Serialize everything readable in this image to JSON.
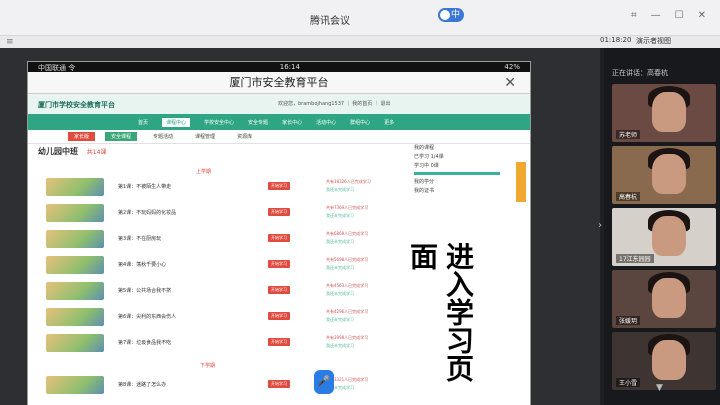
{
  "window": {
    "title": "腾讯会议",
    "lang_pill": "中",
    "timer": "01:18:20",
    "view_label": "演示者视图"
  },
  "phone": {
    "status_left": "中国联通 令",
    "status_time": "16:14",
    "status_right": "42%",
    "app_title": "厦门市安全教育平台",
    "close_symbol": "✕"
  },
  "site": {
    "logo_title": "厦门市学校安全教育平台",
    "user_text": "欢迎您，brambojhang1537 ｜ 我的首页 ｜ 退出",
    "nav": [
      "首页",
      "课程中心",
      "学校安全中心",
      "安全专题",
      "家长中心",
      "活动中心",
      "群组中心",
      "更多"
    ],
    "nav_active_index": 1,
    "subnav": [
      "家长版",
      "安全课程",
      "专题活动",
      "课程管理",
      "资源库"
    ],
    "course_head": "幼儿园中班",
    "course_count": "共14课",
    "term_top": "上学期",
    "term_bottom": "下学期",
    "lessons": [
      {
        "name": "第1课：不被陌生人带走",
        "btn": "开始学习",
        "stat": "共有18326人已完成学习",
        "stat2": "我还未完成学习"
      },
      {
        "name": "第2课：不玩妈妈的化妆品",
        "btn": "开始学习",
        "stat": "共有7369人已完成学习",
        "stat2": "我还未完成学习"
      },
      {
        "name": "第3课：不在厨房玩",
        "btn": "开始学习",
        "stat": "共有6869人已完成学习",
        "stat2": "我还未完成学习"
      },
      {
        "name": "第4课：荡秋千要小心",
        "btn": "开始学习",
        "stat": "共有5698人已完成学习",
        "stat2": "我还未完成学习"
      },
      {
        "name": "第5课：公共场合我不挤",
        "btn": "开始学习",
        "stat": "共有4563人已完成学习",
        "stat2": "我还未完成学习"
      },
      {
        "name": "第6课：尖利的东西会伤人",
        "btn": "开始学习",
        "stat": "共有4296人已完成学习",
        "stat2": "我还未完成学习"
      },
      {
        "name": "第7课：垃圾食品我不吃",
        "btn": "开始学习",
        "stat": "共有3998人已完成学习",
        "stat2": "我还未完成学习"
      },
      {
        "name": "第8课：迷路了怎么办",
        "btn": "开始学习",
        "stat": "共有3321人已完成学习",
        "stat2": "我还未完成学习"
      }
    ],
    "side": {
      "line1": "我的课程",
      "line2": "已学习 1/4课",
      "line3": "学习中 0课",
      "line4": "我的学分",
      "line5": "我的证书"
    }
  },
  "overlay": {
    "text": "进入学习页面"
  },
  "panel": {
    "speaking": "正在讲话：高春杭",
    "participants": [
      {
        "label": "苏老师"
      },
      {
        "label": "高春杭"
      },
      {
        "label": "17江东园园"
      },
      {
        "label": "张媛玥"
      },
      {
        "label": "王小雪"
      }
    ]
  }
}
